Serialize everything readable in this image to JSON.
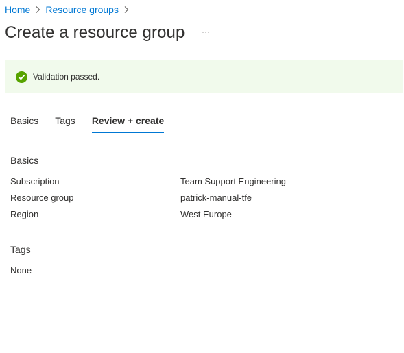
{
  "breadcrumb": {
    "items": [
      "Home",
      "Resource groups"
    ]
  },
  "page": {
    "title": "Create a resource group",
    "more_label": "···"
  },
  "validation": {
    "message": "Validation passed.",
    "status": "success",
    "icon": "checkmark-circle-icon",
    "color": "#57a300"
  },
  "tabs": [
    {
      "label": "Basics",
      "active": false
    },
    {
      "label": "Tags",
      "active": false
    },
    {
      "label": "Review + create",
      "active": true
    }
  ],
  "review": {
    "basics": {
      "heading": "Basics",
      "rows": [
        {
          "label": "Subscription",
          "value": "Team Support Engineering"
        },
        {
          "label": "Resource group",
          "value": "patrick-manual-tfe"
        },
        {
          "label": "Region",
          "value": "West Europe"
        }
      ]
    },
    "tags": {
      "heading": "Tags",
      "value": "None"
    }
  },
  "colors": {
    "accent": "#0078d4",
    "success_bg": "#f1faec",
    "text": "#323130"
  }
}
